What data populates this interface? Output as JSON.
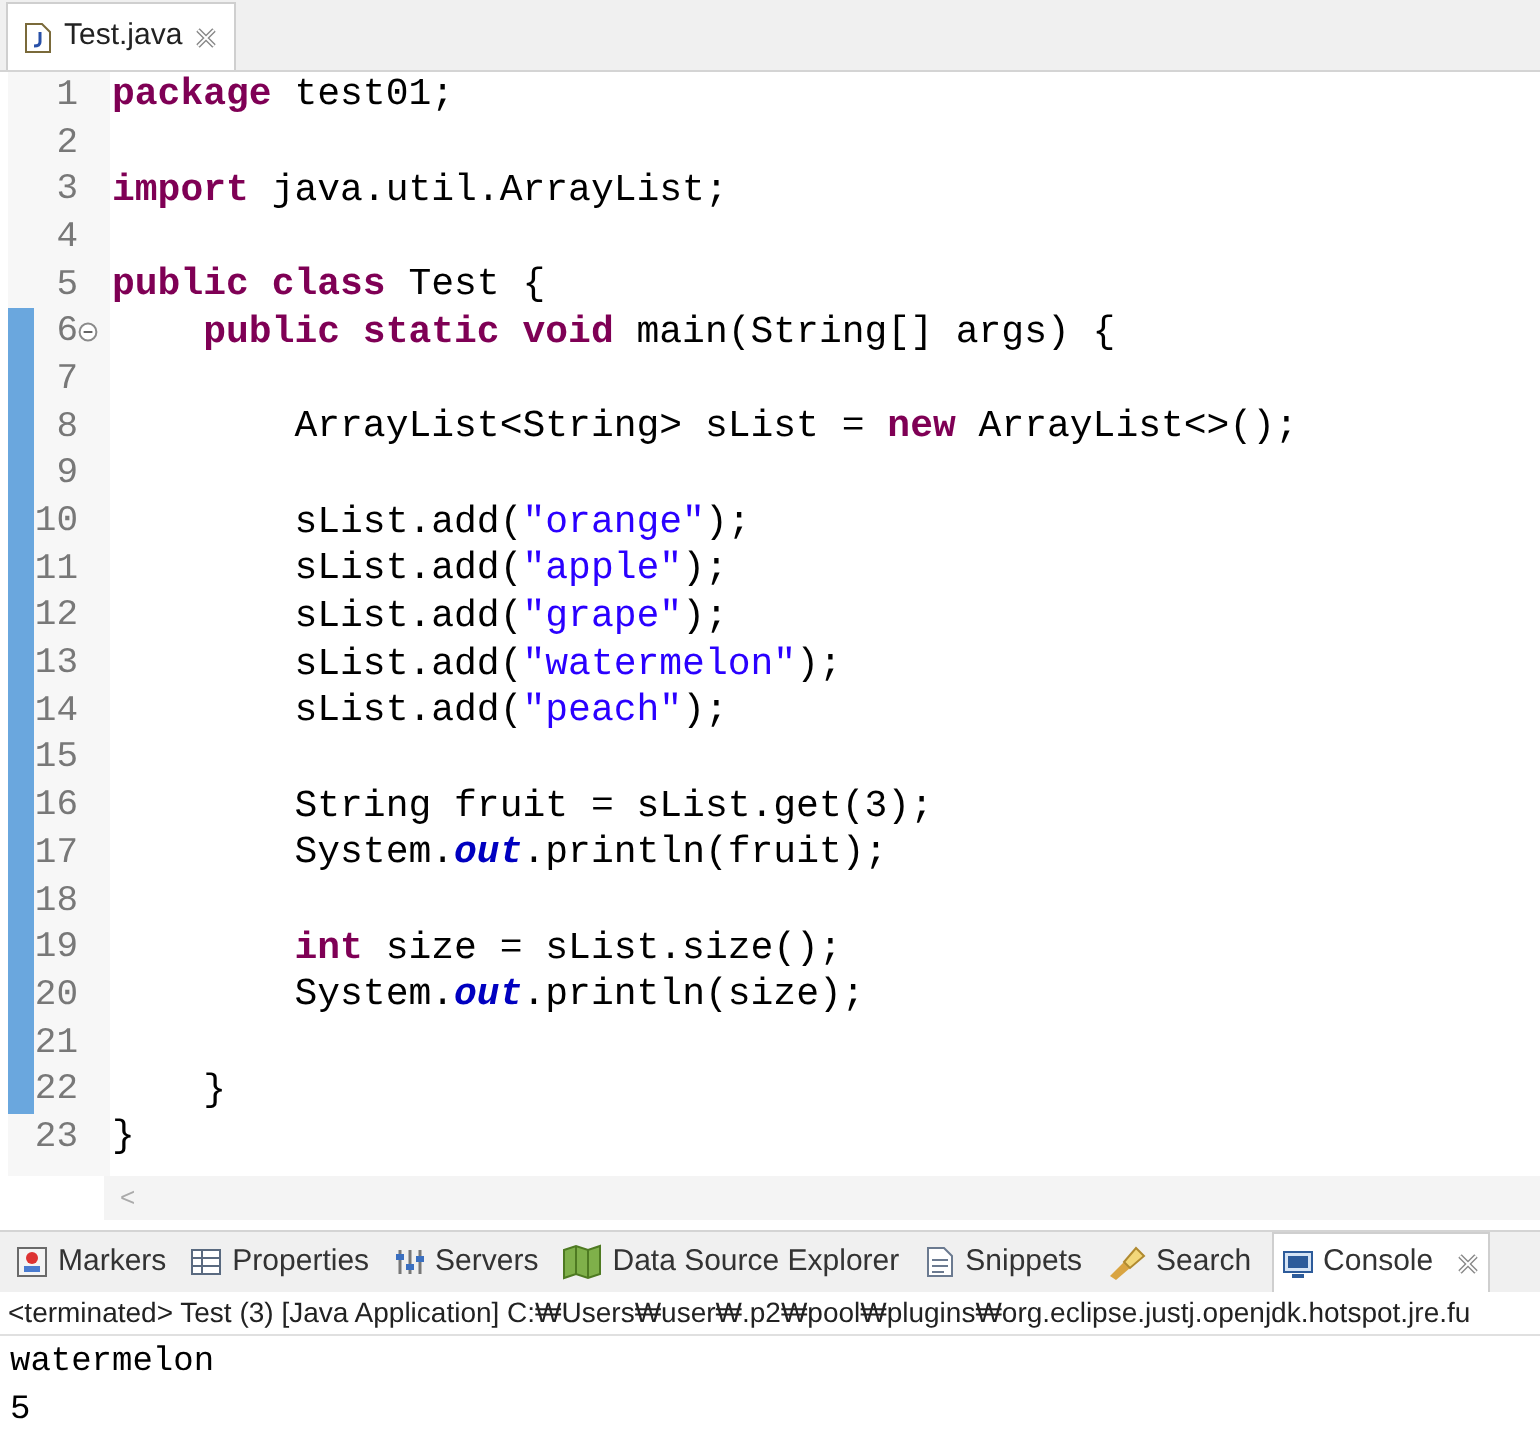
{
  "editor_tab": {
    "title": "Test.java",
    "closable": true
  },
  "code_lines": [
    {
      "number": "1",
      "marked": false,
      "fold": false,
      "tokens": [
        {
          "kind": "keyword",
          "text": "package"
        },
        {
          "kind": "plain",
          "text": " test01;"
        }
      ]
    },
    {
      "number": "2",
      "marked": false,
      "fold": false
    },
    {
      "number": "3",
      "marked": false,
      "fold": false,
      "tokens": [
        {
          "kind": "keyword",
          "text": "import"
        },
        {
          "kind": "plain",
          "text": " java.util.ArrayList;"
        }
      ]
    },
    {
      "number": "4",
      "marked": false,
      "fold": false
    },
    {
      "number": "5",
      "marked": false,
      "fold": false,
      "tokens": [
        {
          "kind": "keyword",
          "text": "public class"
        },
        {
          "kind": "plain",
          "text": " Test {"
        }
      ]
    },
    {
      "number": "6",
      "marked": true,
      "fold": true,
      "tokens": [
        {
          "kind": "keyword",
          "text": "    public static void"
        },
        {
          "kind": "plain",
          "text": " main(String[] args) {"
        }
      ]
    },
    {
      "number": "7",
      "marked": true,
      "fold": false
    },
    {
      "number": "8",
      "marked": true,
      "fold": false,
      "tokens": [
        {
          "kind": "plain",
          "text": "        ArrayList<String> sList = "
        },
        {
          "kind": "keyword",
          "text": "new"
        },
        {
          "kind": "plain",
          "text": " ArrayList<>();"
        }
      ]
    },
    {
      "number": "9",
      "marked": true,
      "fold": false
    },
    {
      "number": "10",
      "marked": true,
      "fold": false,
      "tokens": [
        {
          "kind": "plain",
          "text": "        sList.add("
        },
        {
          "kind": "string",
          "text": "\"orange\""
        },
        {
          "kind": "plain",
          "text": ");"
        }
      ]
    },
    {
      "number": "11",
      "marked": true,
      "fold": false,
      "tokens": [
        {
          "kind": "plain",
          "text": "        sList.add("
        },
        {
          "kind": "string",
          "text": "\"apple\""
        },
        {
          "kind": "plain",
          "text": ");"
        }
      ]
    },
    {
      "number": "12",
      "marked": true,
      "fold": false,
      "tokens": [
        {
          "kind": "plain",
          "text": "        sList.add("
        },
        {
          "kind": "string",
          "text": "\"grape\""
        },
        {
          "kind": "plain",
          "text": ");"
        }
      ]
    },
    {
      "number": "13",
      "marked": true,
      "fold": false,
      "tokens": [
        {
          "kind": "plain",
          "text": "        sList.add("
        },
        {
          "kind": "string",
          "text": "\"watermelon\""
        },
        {
          "kind": "plain",
          "text": ");"
        }
      ]
    },
    {
      "number": "14",
      "marked": true,
      "fold": false,
      "tokens": [
        {
          "kind": "plain",
          "text": "        sList.add("
        },
        {
          "kind": "string",
          "text": "\"peach\""
        },
        {
          "kind": "plain",
          "text": ");"
        }
      ]
    },
    {
      "number": "15",
      "marked": true,
      "fold": false
    },
    {
      "number": "16",
      "marked": true,
      "fold": false,
      "tokens": [
        {
          "kind": "plain",
          "text": "        String fruit = sList.get(3);"
        }
      ]
    },
    {
      "number": "17",
      "marked": true,
      "fold": false,
      "tokens": [
        {
          "kind": "plain",
          "text": "        System."
        },
        {
          "kind": "field",
          "text": "out"
        },
        {
          "kind": "plain",
          "text": ".println(fruit);"
        }
      ]
    },
    {
      "number": "18",
      "marked": true,
      "fold": false
    },
    {
      "number": "19",
      "marked": true,
      "fold": false,
      "tokens": [
        {
          "kind": "keyword",
          "text": "        int"
        },
        {
          "kind": "plain",
          "text": " size = sList.size();"
        }
      ]
    },
    {
      "number": "20",
      "marked": true,
      "fold": false,
      "tokens": [
        {
          "kind": "plain",
          "text": "        System."
        },
        {
          "kind": "field",
          "text": "out"
        },
        {
          "kind": "plain",
          "text": ".println(size);"
        }
      ]
    },
    {
      "number": "21",
      "marked": true,
      "fold": false
    },
    {
      "number": "22",
      "marked": true,
      "fold": false,
      "tokens": [
        {
          "kind": "plain",
          "text": "    }"
        }
      ]
    },
    {
      "number": "23",
      "marked": false,
      "fold": false,
      "tokens": [
        {
          "kind": "plain",
          "text": "}"
        }
      ]
    }
  ],
  "scrollbar_arrow": "<",
  "panel_tabs": [
    {
      "label": "Markers",
      "selected": false,
      "closable": false
    },
    {
      "label": "Properties",
      "selected": false,
      "closable": false
    },
    {
      "label": "Servers",
      "selected": false,
      "closable": false
    },
    {
      "label": "Data Source Explorer",
      "selected": false,
      "closable": false
    },
    {
      "label": "Snippets",
      "selected": false,
      "closable": false
    },
    {
      "label": "Search",
      "selected": false,
      "closable": false
    },
    {
      "label": "Console",
      "selected": true,
      "closable": true
    }
  ],
  "console": {
    "status": "<terminated> Test (3) [Java Application] C:₩Users₩user₩.p2₩pool₩plugins₩org.eclipse.justj.openjdk.hotspot.jre.fu",
    "output": [
      "watermelon",
      "5"
    ]
  }
}
